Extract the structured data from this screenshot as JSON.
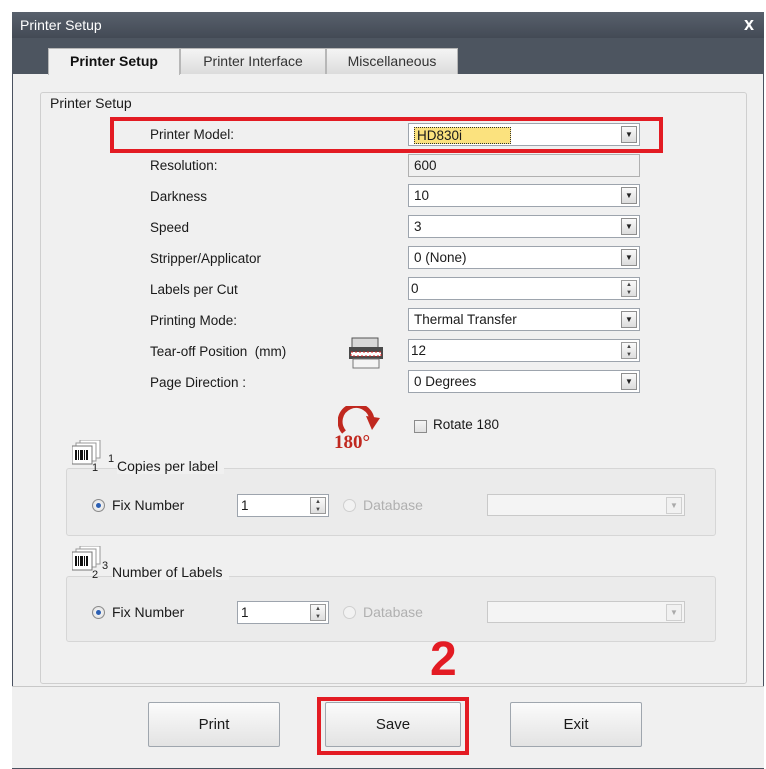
{
  "window": {
    "title": "Printer Setup",
    "close_label": "x"
  },
  "tabs": [
    {
      "label": "Printer Setup",
      "active": true
    },
    {
      "label": "Printer Interface",
      "active": false
    },
    {
      "label": "Miscellaneous",
      "active": false
    }
  ],
  "panel": {
    "legend": "Printer Setup",
    "rows": [
      {
        "label": "Printer Model:",
        "value": "HD830i",
        "control": "dropdown",
        "highlighted": true
      },
      {
        "label": "Resolution:",
        "value": "600",
        "control": "readonly"
      },
      {
        "label": "Darkness",
        "value": "10",
        "control": "dropdown"
      },
      {
        "label": "Speed",
        "value": "3",
        "control": "dropdown"
      },
      {
        "label": "Stripper/Applicator",
        "value": "0 (None)",
        "control": "dropdown"
      },
      {
        "label": "Labels per Cut",
        "value": "0",
        "control": "spinner"
      },
      {
        "label": "Printing Mode:",
        "value": "Thermal Transfer",
        "control": "dropdown"
      },
      {
        "label": "Tear-off Position  (mm)",
        "value": "12",
        "control": "spinner"
      },
      {
        "label": "Page Direction :",
        "value": "0 Degrees",
        "control": "dropdown"
      }
    ],
    "rotate": {
      "icon_text": "180°",
      "checkbox_label": "Rotate 180",
      "checked": false
    }
  },
  "copies_group": {
    "icon_sub": "1",
    "icon_sup": "1",
    "title": "Copies per label",
    "fix_label": "Fix Number",
    "fix_value": "1",
    "database_label": "Database",
    "selected": "fix"
  },
  "labels_group": {
    "icon_sub": "2",
    "icon_sup": "3",
    "title": "Number of Labels",
    "fix_label": "Fix Number",
    "fix_value": "1",
    "database_label": "Database",
    "selected": "fix"
  },
  "buttons": {
    "print": "Print",
    "save": "Save",
    "exit": "Exit"
  },
  "annotation": {
    "step": "2"
  },
  "colors": {
    "highlight": "#e31b23",
    "titlebar": "#434a55",
    "model_selection": "#fbe27e"
  }
}
